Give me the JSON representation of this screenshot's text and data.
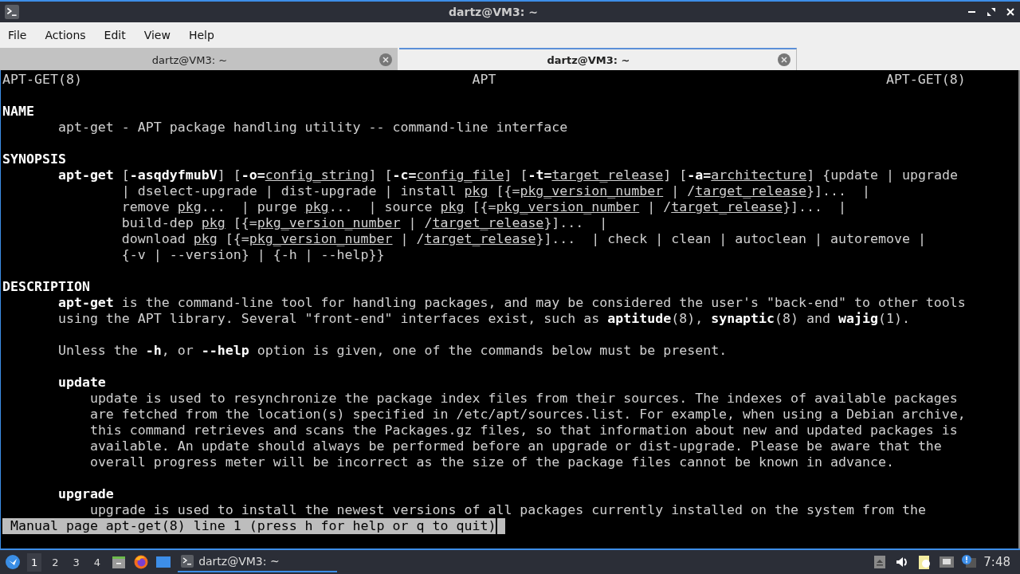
{
  "window": {
    "title": "dartz@VM3: ~"
  },
  "menu": [
    "File",
    "Actions",
    "Edit",
    "View",
    "Help"
  ],
  "tabs": [
    {
      "label": "dartz@VM3: ~",
      "selected": false
    },
    {
      "label": "dartz@VM3: ~",
      "selected": true
    }
  ],
  "terminal": {
    "header": {
      "left": "APT-GET(8)",
      "center": "APT",
      "right": "APT-GET(8)"
    },
    "lines": [
      {
        "kind": "blank"
      },
      {
        "kind": "heading",
        "text": "NAME"
      },
      {
        "kind": "body",
        "text": "apt-get - APT package handling utility -- command-line interface"
      },
      {
        "kind": "blank"
      },
      {
        "kind": "heading",
        "text": "SYNOPSIS"
      },
      {
        "kind": "body",
        "parts": [
          "**apt-get** [**-asqdyfmubV**] [**-o=**",
          "*config_string*] [**-c=**",
          "*config_file*] [**-t=**",
          "*target_release*] [**-a=**",
          "*architecture*] {update | upgrade"
        ]
      },
      {
        "kind": "wrap",
        "text": "| dselect-upgrade | dist-upgrade | install *pkg* [{=*pkg_version_number* | /*target_release*}]...  |"
      },
      {
        "kind": "wrap",
        "text": "remove *pkg*...  | purge *pkg*...  | source *pkg* [{=*pkg_version_number* | /*target_release*}]...  |"
      },
      {
        "kind": "wrap",
        "text": "build-dep *pkg* [{=*pkg_version_number* | /*target_release*}]...  |"
      },
      {
        "kind": "wrap",
        "text": "download *pkg* [{=*pkg_version_number* | /*target_release*}]...  | check | clean | autoclean | autoremove |"
      },
      {
        "kind": "wrap",
        "text": "{-v | --version} | {-h | --help}}"
      },
      {
        "kind": "blank"
      },
      {
        "kind": "heading",
        "text": "DESCRIPTION"
      },
      {
        "kind": "body",
        "text": "**apt-get** is the command-line tool for handling packages, and may be considered the user's \"back-end\" to other tools"
      },
      {
        "kind": "body",
        "text": "using the APT library. Several \"front-end\" interfaces exist, such as **aptitude**(8), **synaptic**(8) and **wajig**(1)."
      },
      {
        "kind": "blank"
      },
      {
        "kind": "body",
        "text": "Unless the **-h**, or **--help** option is given, one of the commands below must be present."
      },
      {
        "kind": "blank"
      },
      {
        "kind": "subheading",
        "text": "update"
      },
      {
        "kind": "para",
        "text": "update is used to resynchronize the package index files from their sources. The indexes of available packages"
      },
      {
        "kind": "para",
        "text": "are fetched from the location(s) specified in /etc/apt/sources.list. For example, when using a Debian archive,"
      },
      {
        "kind": "para",
        "text": "this command retrieves and scans the Packages.gz files, so that information about new and updated packages is"
      },
      {
        "kind": "para",
        "text": "available. An update should always be performed before an upgrade or dist-upgrade. Please be aware that the"
      },
      {
        "kind": "para",
        "text": "overall progress meter will be incorrect as the size of the package files cannot be known in advance."
      },
      {
        "kind": "blank"
      },
      {
        "kind": "subheading",
        "text": "upgrade"
      },
      {
        "kind": "para",
        "text": "upgrade is used to install the newest versions of all packages currently installed on the system from the"
      }
    ],
    "status": "Manual page apt-get(8) line 1 (press h for help or q to quit)"
  },
  "taskbar": {
    "workspaces": [
      {
        "label": "1",
        "selected": true
      },
      {
        "label": "2",
        "selected": false
      },
      {
        "label": "3",
        "selected": false
      },
      {
        "label": "4",
        "selected": false
      }
    ],
    "tasks": [
      {
        "label": "dartz@VM3: ~",
        "selected": true
      }
    ],
    "clock": "7:48"
  }
}
